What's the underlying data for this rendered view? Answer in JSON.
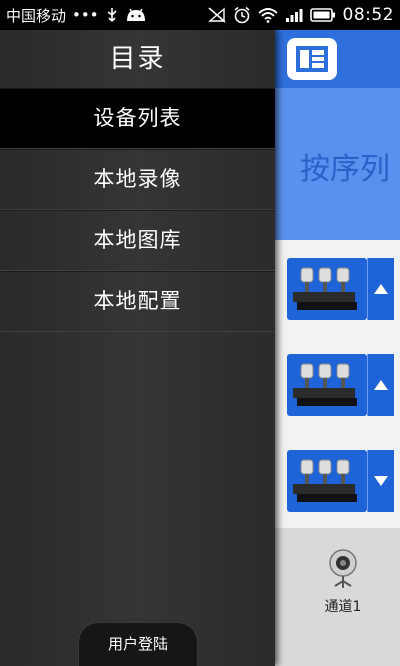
{
  "status_bar": {
    "carrier": "中国移动",
    "dots": "•••",
    "time": "08:52",
    "icons": [
      "usb-icon",
      "android-icon",
      "signal-off-icon",
      "alarm-icon",
      "wifi-icon",
      "cell-signal-icon",
      "battery-icon"
    ]
  },
  "drawer": {
    "title": "目录",
    "items": [
      {
        "label": "设备列表",
        "active": true
      },
      {
        "label": "本地录像",
        "active": false
      },
      {
        "label": "本地图库",
        "active": false
      },
      {
        "label": "本地配置",
        "active": false
      }
    ],
    "login_label": "用户登陆"
  },
  "content": {
    "header_title": "按序列",
    "devices": [
      {
        "arrow": "up"
      },
      {
        "arrow": "up"
      },
      {
        "arrow": "down"
      }
    ],
    "channel_label": "通道1"
  },
  "colors": {
    "accent": "#2f6fdc",
    "header": "#5b91ee",
    "device_blue": "#1f63d8"
  }
}
